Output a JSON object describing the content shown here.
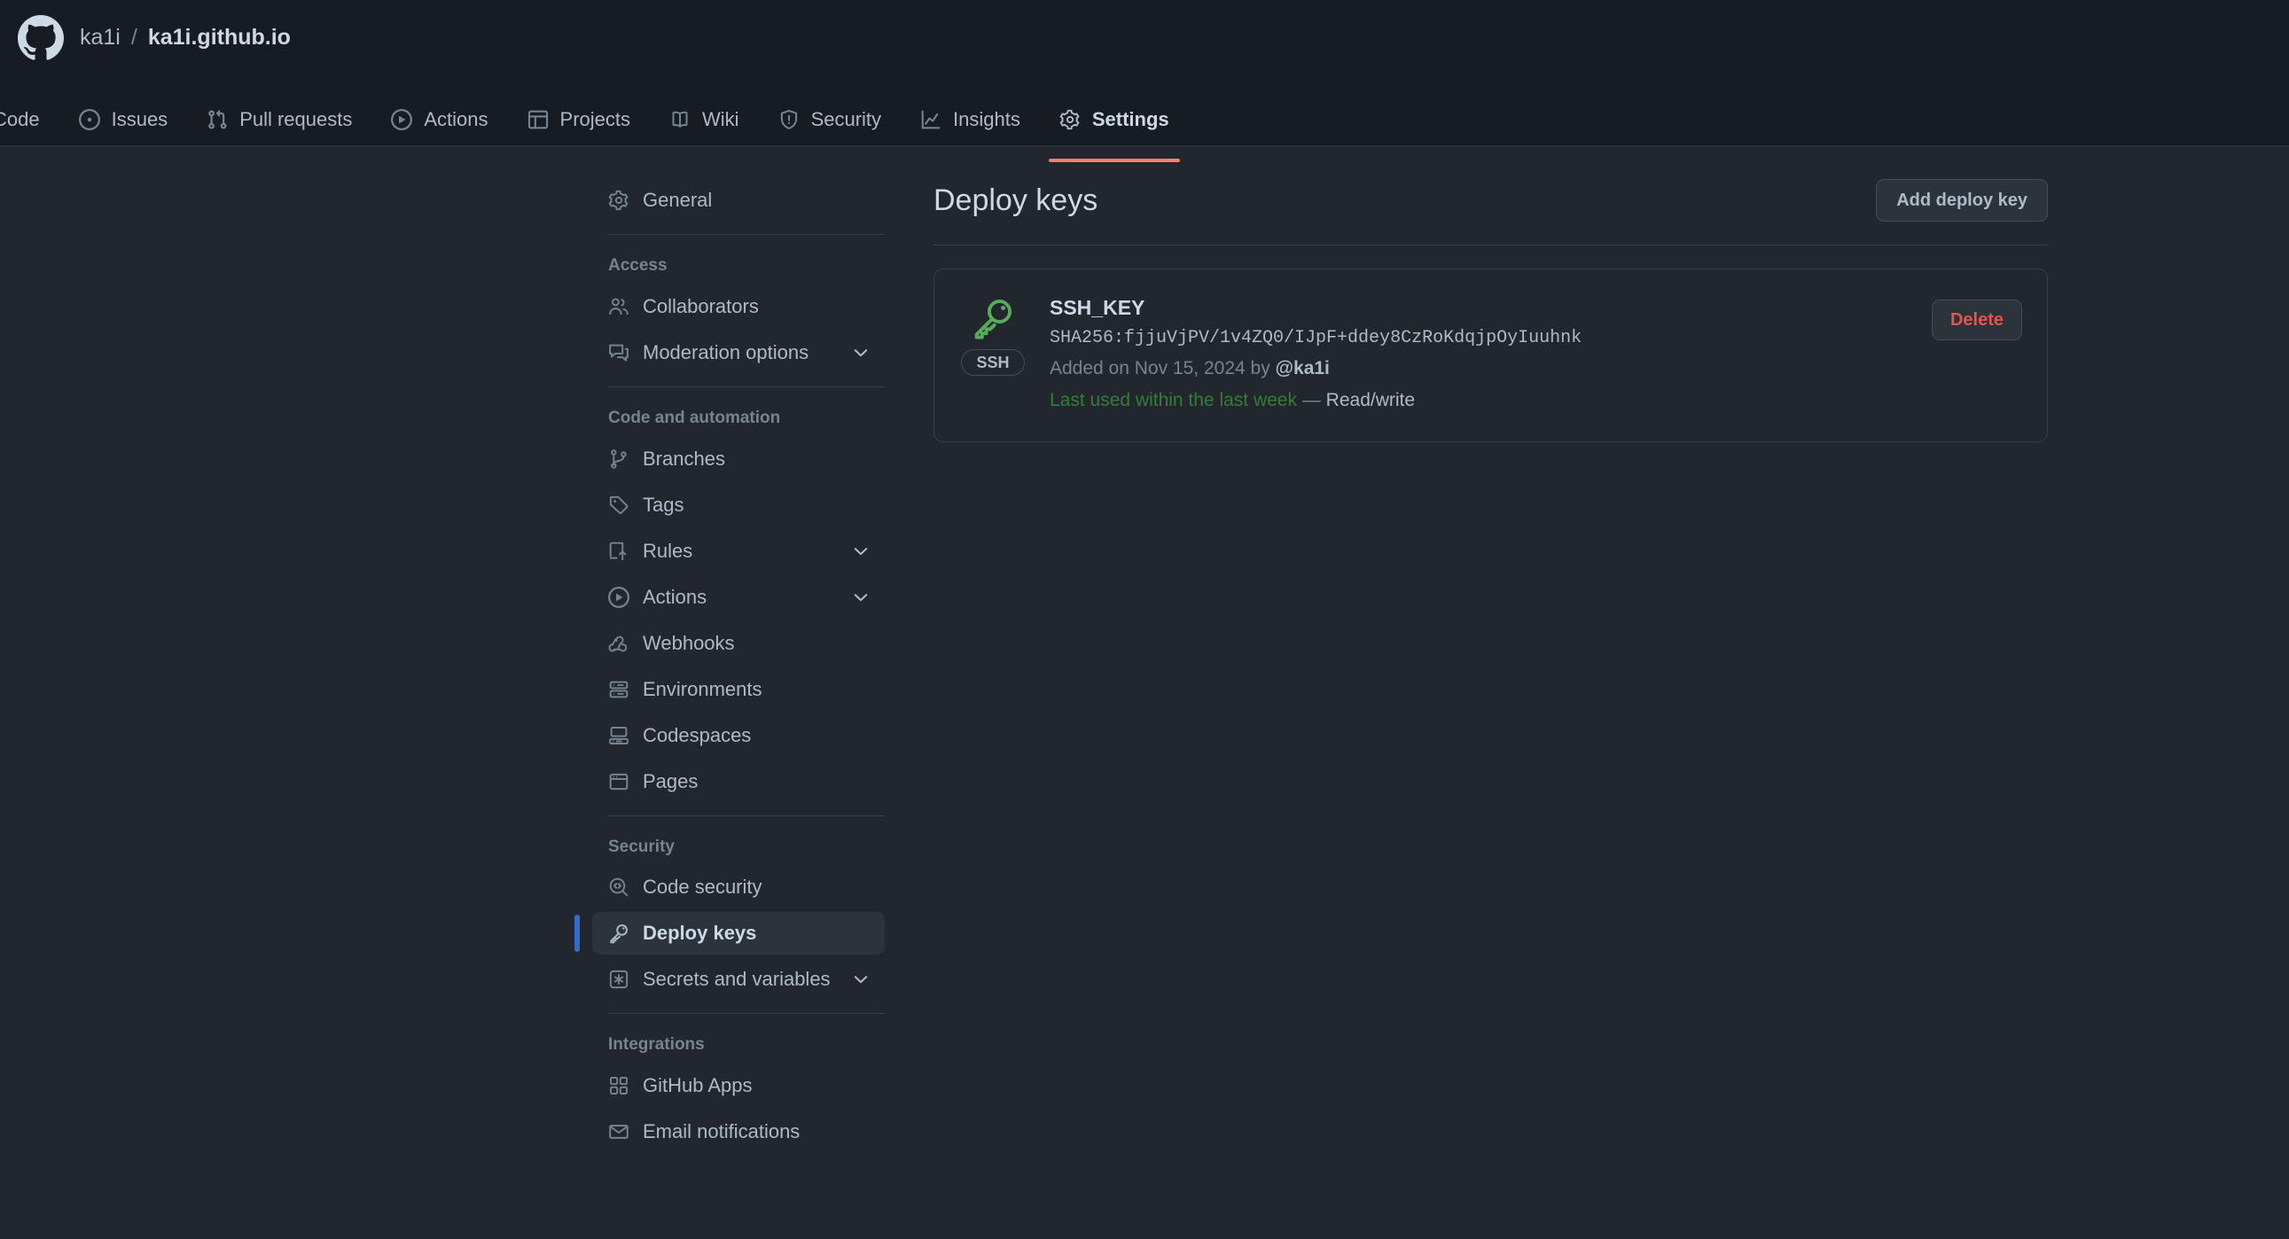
{
  "header": {
    "logo_icon": "github-mark-icon",
    "repo": {
      "owner": "ka1i",
      "separator": "/",
      "name": "ka1i.github.io"
    },
    "tabs": [
      {
        "label": "Code",
        "icon": "code-icon",
        "active": false
      },
      {
        "label": "Issues",
        "icon": "issue-opened-icon",
        "active": false
      },
      {
        "label": "Pull requests",
        "icon": "git-pull-request-icon",
        "active": false
      },
      {
        "label": "Actions",
        "icon": "play-icon",
        "active": false
      },
      {
        "label": "Projects",
        "icon": "table-icon",
        "active": false
      },
      {
        "label": "Wiki",
        "icon": "book-icon",
        "active": false
      },
      {
        "label": "Security",
        "icon": "shield-icon",
        "active": false
      },
      {
        "label": "Insights",
        "icon": "graph-icon",
        "active": false
      },
      {
        "label": "Settings",
        "icon": "gear-icon",
        "active": true
      }
    ]
  },
  "sidebar": {
    "top": [
      {
        "label": "General",
        "icon": "gear-icon",
        "expandable": false,
        "selected": false
      }
    ],
    "groups": [
      {
        "title": "Access",
        "items": [
          {
            "label": "Collaborators",
            "icon": "people-icon",
            "expandable": false,
            "selected": false
          },
          {
            "label": "Moderation options",
            "icon": "comment-discussion-icon",
            "expandable": true,
            "selected": false
          }
        ]
      },
      {
        "title": "Code and automation",
        "items": [
          {
            "label": "Branches",
            "icon": "git-branch-icon",
            "expandable": false,
            "selected": false
          },
          {
            "label": "Tags",
            "icon": "tag-icon",
            "expandable": false,
            "selected": false
          },
          {
            "label": "Rules",
            "icon": "ruleset-icon",
            "expandable": true,
            "selected": false
          },
          {
            "label": "Actions",
            "icon": "play-icon",
            "expandable": true,
            "selected": false
          },
          {
            "label": "Webhooks",
            "icon": "webhook-icon",
            "expandable": false,
            "selected": false
          },
          {
            "label": "Environments",
            "icon": "server-icon",
            "expandable": false,
            "selected": false
          },
          {
            "label": "Codespaces",
            "icon": "codespaces-icon",
            "expandable": false,
            "selected": false
          },
          {
            "label": "Pages",
            "icon": "browser-icon",
            "expandable": false,
            "selected": false
          }
        ]
      },
      {
        "title": "Security",
        "items": [
          {
            "label": "Code security",
            "icon": "codescan-icon",
            "expandable": false,
            "selected": false
          },
          {
            "label": "Deploy keys",
            "icon": "key-icon",
            "expandable": false,
            "selected": true
          },
          {
            "label": "Secrets and variables",
            "icon": "asterisk-icon",
            "expandable": true,
            "selected": false
          }
        ]
      },
      {
        "title": "Integrations",
        "items": [
          {
            "label": "GitHub Apps",
            "icon": "apps-icon",
            "expandable": false,
            "selected": false
          },
          {
            "label": "Email notifications",
            "icon": "mail-icon",
            "expandable": false,
            "selected": false
          }
        ]
      }
    ]
  },
  "main": {
    "title": "Deploy keys",
    "add_button_label": "Add deploy key",
    "keys": [
      {
        "icon": "key-icon",
        "badge": "SSH",
        "title": "SSH_KEY",
        "fingerprint": "SHA256:fjjuVjPV/1v4ZQ0/IJpF+ddey8CzRoKdqjpOyIuuhnk",
        "added_prefix": "Added on Nov 15, 2024 by ",
        "added_actor": "@ka1i",
        "last_used": "Last used within the last week",
        "status_separator": " — ",
        "permission": "Read/write",
        "delete_label": "Delete"
      }
    ]
  },
  "colors": {
    "page_bg": "#22272e",
    "header_bg": "#171b22",
    "accent_active_tab": "#f78166",
    "selected_indicator": "#316dca",
    "selected_bg": "#2d333b",
    "key_green": "#57ab5a",
    "last_used_green": "#347d39",
    "danger": "#e5534b",
    "border": "#373e47",
    "text_primary": "#cdd9e5",
    "text_secondary": "#adbac7",
    "text_muted": "#768390"
  }
}
